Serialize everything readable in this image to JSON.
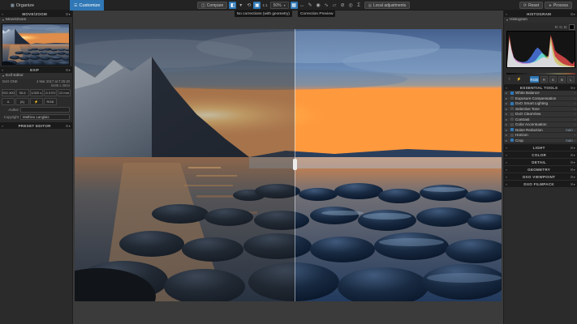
{
  "topbar": {
    "tabs": [
      {
        "label": "Organize",
        "icon": "grid-icon",
        "glyph": "▦",
        "active": false
      },
      {
        "label": "Customize",
        "icon": "sliders-icon",
        "glyph": "☰",
        "active": true
      }
    ],
    "compare": "Compare",
    "compare_icon_glyph": "◫",
    "view_icons": [
      {
        "name": "split-view-icon",
        "glyph": "◧",
        "active": true
      },
      {
        "name": "split-caret-icon",
        "glyph": "▾",
        "active": false
      },
      {
        "name": "rotate-left-icon",
        "glyph": "⟲",
        "active": false
      },
      {
        "name": "fit-screen-icon",
        "glyph": "▣",
        "active": true
      },
      {
        "name": "ratio-1to1-button",
        "glyph": "1:1",
        "active": false
      }
    ],
    "zoom_value": "50%",
    "zoom_caret": "▾",
    "tool_icons": [
      {
        "name": "crop-icon",
        "glyph": "▦",
        "active": true
      },
      {
        "name": "horizon-icon",
        "glyph": "↔",
        "active": false
      },
      {
        "name": "spot-removal-icon",
        "glyph": "✎",
        "active": false
      },
      {
        "name": "red-eye-icon",
        "glyph": "◉",
        "active": false
      },
      {
        "name": "curve-icon",
        "glyph": "∿",
        "active": false
      },
      {
        "name": "mask-icon",
        "glyph": "▱",
        "active": false
      },
      {
        "name": "protect-icon",
        "glyph": "⊘",
        "active": false
      },
      {
        "name": "eye-icon",
        "glyph": "◎",
        "active": false
      },
      {
        "name": "sum-icon",
        "glyph": "Σ",
        "active": false
      }
    ],
    "local_adjustments": "Local adjustments",
    "local_adjustments_icon_glyph": "◎",
    "reset": "Reset",
    "reset_icon_glyph": "⟳",
    "process": "Process",
    "process_icon_glyph": "➤"
  },
  "left_panel": {
    "movezoom": {
      "header": "MOVE/ZOOM",
      "sub": "Move/Zoom",
      "collapse_glyph": "«",
      "menu_glyph": "☰▾",
      "caret": "▾"
    },
    "exif": {
      "header": "EXIF",
      "sub": "Exif Editor",
      "caret": "▾",
      "camera": "DxO ONE",
      "datetime": "4 Mar 2017 at 7:25:20",
      "dimensions": "5406 x 3604",
      "fields": [
        "ISO 400",
        "f/5.6",
        "1/320 s",
        "-0.3 EV",
        "12 mm"
      ],
      "modes": [
        "A",
        "[A]",
        "⚡",
        "RGB"
      ],
      "author_label": "Author",
      "author_value": "",
      "copyright_label": "Copyright",
      "copyright_value": "Mathieu Langlais"
    },
    "preset_editor": {
      "header": "PRESET EDITOR"
    }
  },
  "canvas": {
    "left_label": "No corrections (with geometry)",
    "right_label": "Correction Preview"
  },
  "right_panel": {
    "histogram": {
      "header": "HISTOGRAM",
      "sub": "Histogram",
      "caret": "▾",
      "rgb_readout": "R:  G:  B:",
      "shadow_clip_icon": "☾",
      "highlight_clip_icon": "⚡",
      "channel_buttons": [
        {
          "label": "RGB",
          "active": true
        },
        {
          "label": "R",
          "active": false
        },
        {
          "label": "G",
          "active": false
        },
        {
          "label": "B",
          "active": false
        },
        {
          "label": "L",
          "active": false
        }
      ]
    },
    "essential_tools": {
      "header": "ESSENTIAL TOOLS",
      "items": [
        {
          "label": "White Balance",
          "enabled": true,
          "value": ""
        },
        {
          "label": "Exposure Compensation",
          "enabled": false,
          "value": ""
        },
        {
          "label": "DxO Smart Lighting",
          "enabled": true,
          "value": ""
        },
        {
          "label": "Selective Tone",
          "enabled": false,
          "value": ""
        },
        {
          "label": "DxO ClearView",
          "enabled": false,
          "value": ""
        },
        {
          "label": "Contrast",
          "enabled": false,
          "value": ""
        },
        {
          "label": "Color Accentuation",
          "enabled": false,
          "value": ""
        },
        {
          "label": "Noise Reduction",
          "enabled": true,
          "value": "Auto"
        },
        {
          "label": "Horizon",
          "enabled": false,
          "value": ""
        },
        {
          "label": "Crop",
          "enabled": true,
          "value": "Auto"
        }
      ]
    },
    "sections": [
      "LIGHT",
      "COLOR",
      "DETAIL",
      "GEOMETRY",
      "DXO VIEWPOINT",
      "DXO FILMPACK"
    ]
  },
  "colors": {
    "accent_blue": "#2f77b5",
    "histogram_red": "#e03a3a",
    "histogram_green": "#3ad05a",
    "histogram_blue": "#3a6ae0"
  },
  "chart_data": {
    "type": "area",
    "title": "RGB histogram",
    "x": "luminance 0-255 (32 bins)",
    "ylim": [
      0,
      100
    ],
    "series": [
      {
        "name": "R",
        "values": [
          10,
          95,
          55,
          30,
          22,
          18,
          15,
          13,
          12,
          12,
          12,
          13,
          14,
          16,
          20,
          24,
          28,
          30,
          28,
          35,
          95,
          75,
          50,
          42,
          38,
          34,
          30,
          26,
          20,
          14,
          9,
          18
        ]
      },
      {
        "name": "G",
        "values": [
          8,
          85,
          48,
          26,
          18,
          14,
          12,
          10,
          10,
          10,
          11,
          13,
          16,
          20,
          28,
          36,
          42,
          38,
          32,
          30,
          90,
          55,
          32,
          24,
          18,
          13,
          9,
          7,
          5,
          4,
          3,
          3
        ]
      },
      {
        "name": "B",
        "values": [
          7,
          80,
          50,
          30,
          22,
          18,
          16,
          15,
          16,
          18,
          24,
          32,
          42,
          52,
          58,
          52,
          44,
          34,
          26,
          24,
          70,
          35,
          16,
          9,
          6,
          4,
          3,
          2,
          2,
          1,
          1,
          1
        ]
      }
    ],
    "legend": "off",
    "grid": "off"
  }
}
